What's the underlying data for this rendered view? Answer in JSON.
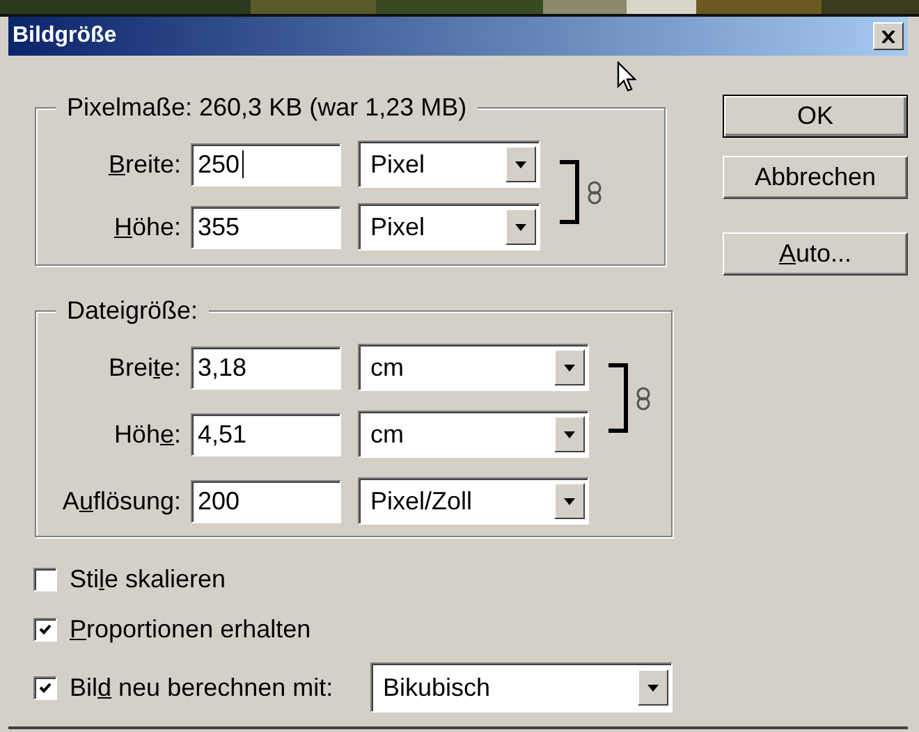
{
  "window": {
    "title": "Bildgröße"
  },
  "pixel_dimensions": {
    "legend": "Pixelmaße: 260,3 KB (war 1,23 MB)",
    "constrained": true,
    "rows": [
      {
        "label_parts": [
          {
            "text": "B",
            "underlined": true
          },
          {
            "text": "reite:",
            "underlined": false
          }
        ],
        "value": "250",
        "focused": true,
        "unit": "Pixel"
      },
      {
        "label_parts": [
          {
            "text": "H",
            "underlined": true
          },
          {
            "text": "öhe:",
            "underlined": false
          }
        ],
        "value": "355",
        "focused": false,
        "unit": "Pixel"
      }
    ]
  },
  "document_size": {
    "legend": "Dateigröße:",
    "constrained": true,
    "rows": [
      {
        "label_parts": [
          {
            "text": "Brei",
            "underlined": false
          },
          {
            "text": "t",
            "underlined": true
          },
          {
            "text": "e:",
            "underlined": false
          }
        ],
        "value": "3,18",
        "focused": false,
        "unit": "cm"
      },
      {
        "label_parts": [
          {
            "text": "Höh",
            "underlined": false
          },
          {
            "text": "e",
            "underlined": true
          },
          {
            "text": ":",
            "underlined": false
          }
        ],
        "value": "4,51",
        "focused": false,
        "unit": "cm"
      },
      {
        "label_parts": [
          {
            "text": "A",
            "underlined": false
          },
          {
            "text": "u",
            "underlined": true
          },
          {
            "text": "flösung:",
            "underlined": false
          }
        ],
        "value": "200",
        "focused": false,
        "unit": "Pixel/Zoll"
      }
    ]
  },
  "options": [
    {
      "label_parts": [
        {
          "text": "Sti",
          "underlined": false
        },
        {
          "text": "l",
          "underlined": true
        },
        {
          "text": "e skalieren",
          "underlined": false
        }
      ],
      "checked": false
    },
    {
      "label_parts": [
        {
          "text": "P",
          "underlined": true
        },
        {
          "text": "roportionen erhalten",
          "underlined": false
        }
      ],
      "checked": true
    },
    {
      "label_parts": [
        {
          "text": "Bil",
          "underlined": false
        },
        {
          "text": "d",
          "underlined": true
        },
        {
          "text": " neu berechnen mit:",
          "underlined": false
        }
      ],
      "checked": true,
      "dropdown": "Bikubisch"
    }
  ],
  "buttons": [
    {
      "label_parts": [
        {
          "text": "OK",
          "underlined": false
        }
      ]
    },
    {
      "label_parts": [
        {
          "text": "Abbrechen",
          "underlined": false
        }
      ]
    },
    {
      "label_parts": [
        {
          "text": "A",
          "underlined": true
        },
        {
          "text": "uto...",
          "underlined": false
        }
      ]
    }
  ]
}
